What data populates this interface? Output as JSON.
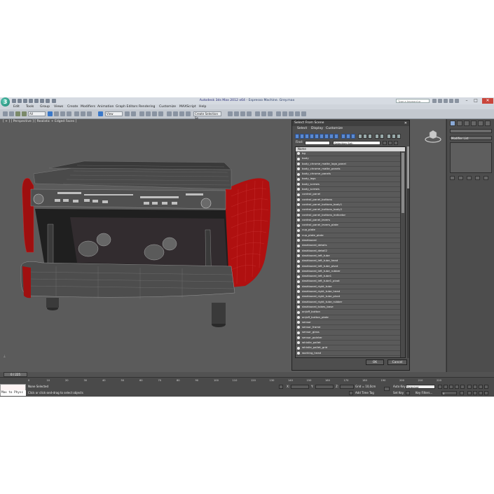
{
  "app": {
    "logo_letter": "3",
    "title_app": "Autodesk 3ds Max 2012 x64",
    "title_sep": " - ",
    "title_file": "Espresso Machine. Grey.max",
    "search_placeholder": "Type a keyword or phrase"
  },
  "menu": [
    "Edit",
    "Tools",
    "Group",
    "Views",
    "Create",
    "Modifiers",
    "Animation",
    "Graph Editors",
    "Rendering",
    "Customize",
    "MAXScript",
    "Help"
  ],
  "toolbar": {
    "filter_value": "All",
    "ref_coord_value": "View",
    "selection_set_value": "Create Selection Se"
  },
  "viewport": {
    "label": "[ + ] [ Perspective ] [ Realistic + Edged Faces ]"
  },
  "command_panel": {
    "modifier_list": "Modifier List"
  },
  "dialog": {
    "title": "Select From Scene",
    "menu": [
      "Select",
      "Display",
      "Customize"
    ],
    "find_label": "Find:",
    "selection_set_placeholder": "Selection Set:",
    "column_header": "Name",
    "items": [
      "bg",
      "body",
      "body_chrome_matte_logo_panel",
      "body_chrome_matte_panels",
      "body_chrome_panels",
      "body_legs",
      "body_screws",
      "body_screws",
      "control_panel",
      "control_panel_buttons",
      "control_panel_buttons_body1",
      "control_panel_buttons_body2",
      "control_panel_buttons_indicator",
      "control_panel_levers",
      "control_panel_levers_plate",
      "cup_plate",
      "cup_plate_plate",
      "dashboard",
      "dashboard_details",
      "dashboard_detail2",
      "dashboard_left_tube",
      "dashboard_left_tube_head",
      "dashboard_left_tube_pivot",
      "dashboard_left_tube_rubber",
      "dashboard_left_tube1",
      "dashboard_left_tube1_pivot",
      "dashboard_right_tube",
      "dashboard_right_tube_head",
      "dashboard_right_tube_pivot",
      "dashboard_right_tube_rubber",
      "dashboard_tubes_base",
      "on/off_button",
      "on/off_button_plate",
      "sensor",
      "sensor_frame",
      "sensor_glass",
      "sensor_pointer",
      "whistle_pallet",
      "whistle_pallet_grid",
      "working_head"
    ],
    "ok_label": "OK",
    "cancel_label": "Cancel"
  },
  "timeline": {
    "frame_label": "0 / 225",
    "ticks": [
      "0",
      "10",
      "20",
      "30",
      "40",
      "50",
      "60",
      "70",
      "80",
      "90",
      "100",
      "110",
      "120",
      "130",
      "140",
      "150",
      "160",
      "170",
      "180",
      "190",
      "200",
      "210",
      "220"
    ]
  },
  "status": {
    "maxscript_text": "Max to Physc",
    "selection": "None Selected",
    "prompt": "Click or click-and-drag to select objects",
    "x_label": "X:",
    "y_label": "Y:",
    "z_label": "Z:",
    "grid": "Grid = 10,0cm",
    "add_time_tag": "Add Time Tag",
    "auto_key": "Auto Key",
    "auto_key_value": "Selected",
    "set_key": "Set Key",
    "key_filters": "Key Filters...",
    "frame_value": "0"
  },
  "colors": {
    "viewport_bg": "#5b5b5b",
    "dialog_bg": "#4e4e4e",
    "machine_red": "#b01010"
  }
}
